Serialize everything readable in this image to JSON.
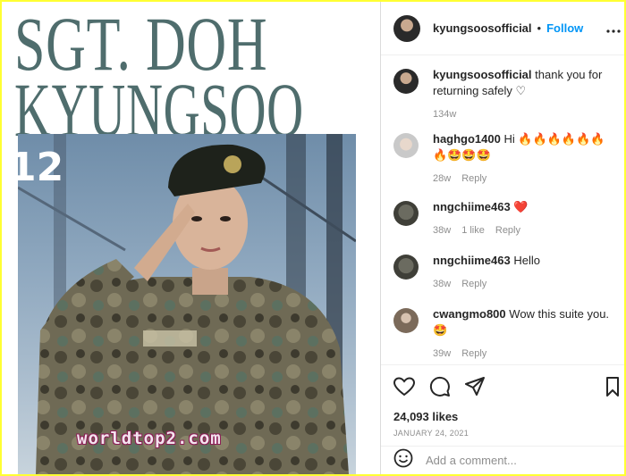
{
  "media": {
    "headline_line1": "SGT. DOH",
    "headline_line2": "KYUNGSOO",
    "badge_number": "12"
  },
  "post": {
    "username": "kyungsoosofficial",
    "separator": "•",
    "follow_label": "Follow",
    "more_icon": "more-horizontal-icon"
  },
  "comments": [
    {
      "user": "kyungsoosofficial",
      "text": "thank you for returning safely ♡",
      "time": "134w",
      "likes": "",
      "reply": ""
    },
    {
      "user": "haghgo1400",
      "text": "Hi 🔥🔥🔥🔥🔥🔥🔥🤩🤩🤩",
      "time": "28w",
      "likes": "",
      "reply": "Reply"
    },
    {
      "user": "nngchiime463",
      "text": "❤️",
      "time": "38w",
      "likes": "1 like",
      "reply": "Reply"
    },
    {
      "user": "nngchiime463",
      "text": "Hello",
      "time": "38w",
      "likes": "",
      "reply": "Reply"
    },
    {
      "user": "cwangmo800",
      "text": "Wow this suite you. 🤩",
      "time": "39w",
      "likes": "",
      "reply": "Reply"
    }
  ],
  "actions": {
    "likes": "24,093 likes",
    "date": "JANUARY 24, 2021",
    "add_comment_placeholder": "Add a comment..."
  },
  "watermark": "worldtop2.com"
}
